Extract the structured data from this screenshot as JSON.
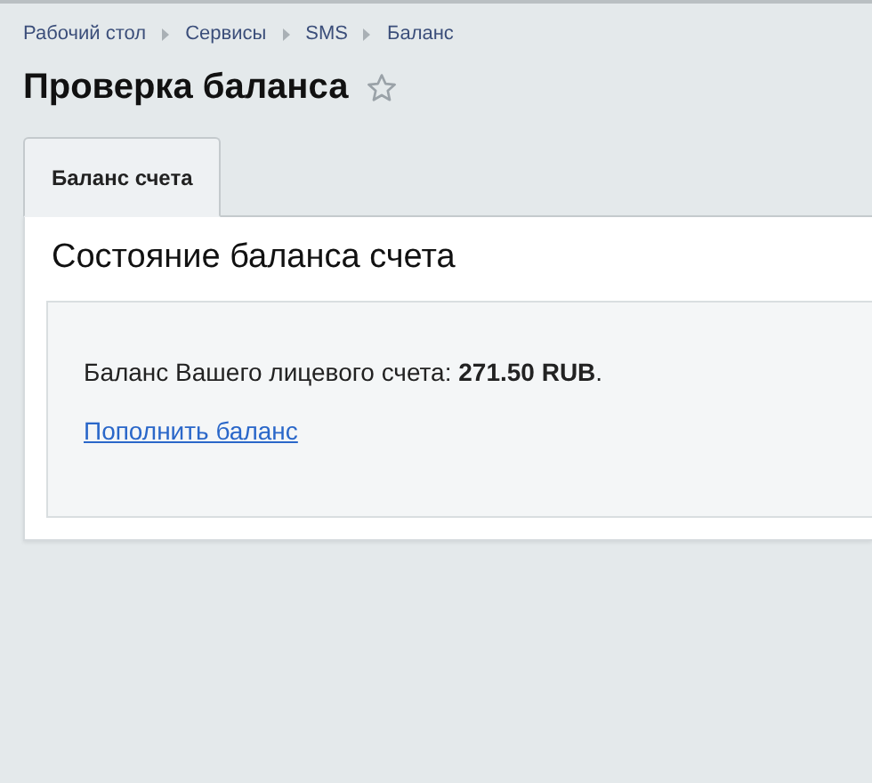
{
  "breadcrumbs": [
    "Рабочий стол",
    "Сервисы",
    "SMS",
    "Баланс"
  ],
  "page_title": "Проверка баланса",
  "tabs": [
    {
      "label": "Баланс счета",
      "selected": true
    }
  ],
  "panel": {
    "heading": "Состояние баланса счета",
    "balance_text": "Баланс Вашего лицевого счета: **271.50 RUB**.",
    "topup_link": "Пополнить баланс"
  }
}
